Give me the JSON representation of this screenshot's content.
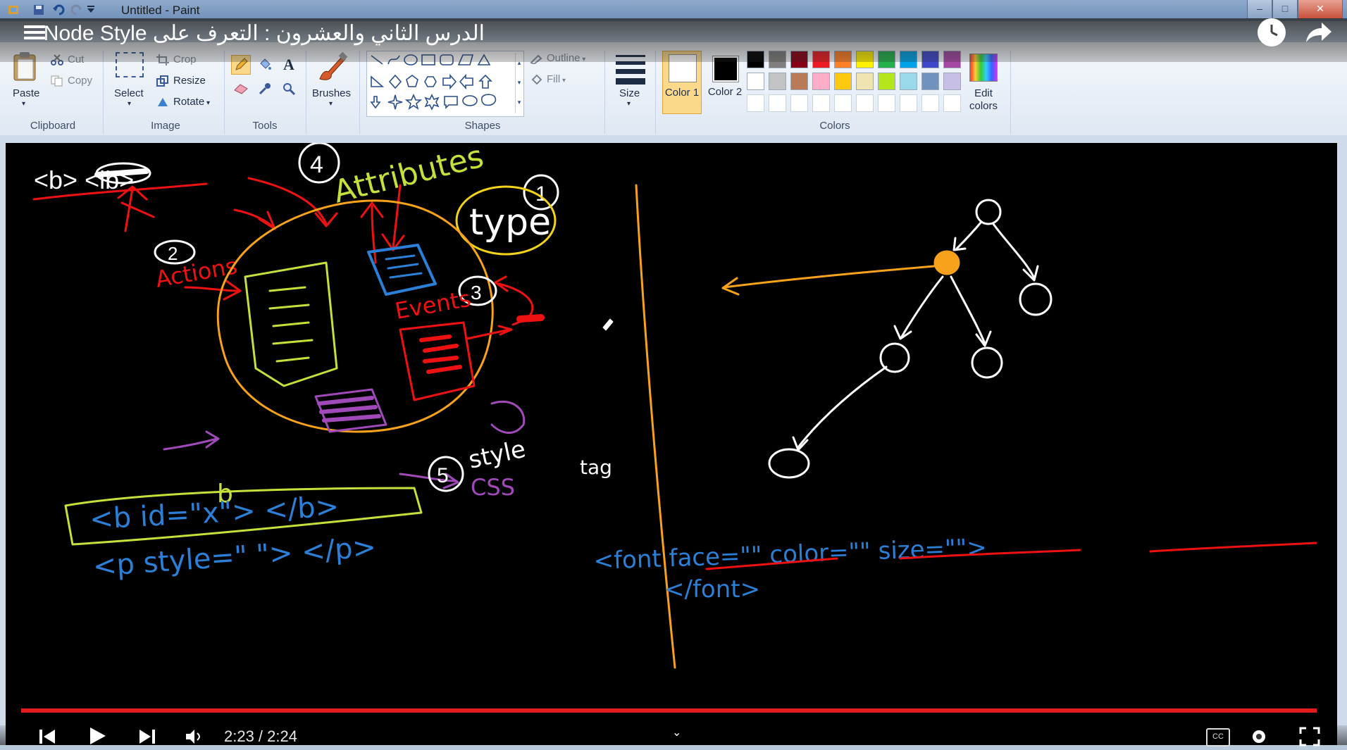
{
  "paint": {
    "window_title": "Untitled - Paint",
    "ribbon": {
      "clipboard": {
        "paste": "Paste",
        "cut": "Cut",
        "copy": "Copy",
        "group": "Clipboard"
      },
      "image": {
        "select": "Select",
        "crop": "Crop",
        "resize": "Resize",
        "rotate": "Rotate",
        "group": "Image"
      },
      "tools": {
        "group": "Tools"
      },
      "brushes": {
        "label": "Brushes"
      },
      "shapes": {
        "outline": "Outline",
        "fill": "Fill",
        "group": "Shapes"
      },
      "size": {
        "label": "Size"
      },
      "colors": {
        "color1": "Color 1",
        "color2": "Color 2",
        "edit": "Edit colors",
        "group": "Colors",
        "row1": [
          "#000000",
          "#7f7f7f",
          "#880015",
          "#ed1c24",
          "#ff7f27",
          "#fff200",
          "#22b14c",
          "#00a2e8",
          "#3f48cc",
          "#a349a4"
        ],
        "row2": [
          "#ffffff",
          "#c3c3c3",
          "#b97a57",
          "#ffaec9",
          "#ffc90e",
          "#efe4b0",
          "#b5e61d",
          "#99d9ea",
          "#7092be",
          "#c8bfe7"
        ]
      }
    }
  },
  "video": {
    "title": "الدرس الثاني والعشرون : التعرف على Node Style",
    "timecode": "2:23 / 2:24",
    "progress": 0.993
  },
  "drawing_text": {
    "attributes": "Attributes",
    "type": "type",
    "actions": "Actions",
    "events": "Events",
    "style": "style",
    "css": "CSS",
    "tag": "tag",
    "b_letter": "b",
    "num1": "1",
    "num2": "2",
    "num3": "3",
    "num4": "4",
    "num5": "5",
    "b_tag": "<b> <lb>",
    "b_id": "<b id=\"x\"> </b>",
    "p_style": "<p style=\" \"> </p>",
    "font_line": "<font face=\"\" color=\"\" size=\"\">",
    "font_close": "</font>"
  }
}
